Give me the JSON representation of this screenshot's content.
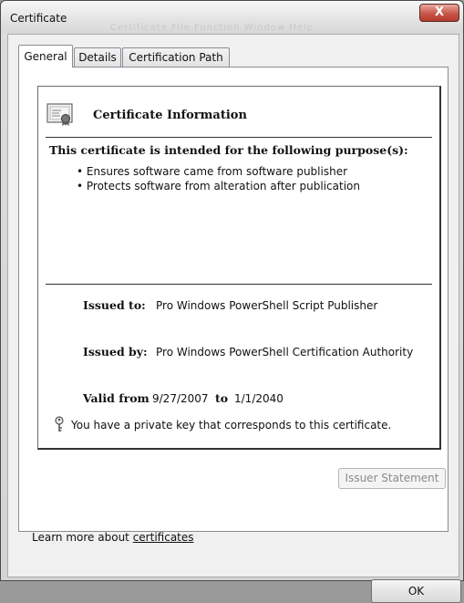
{
  "window": {
    "title": "Certificate",
    "background_title_ghost": "Certificate   File   Function   Window   Help",
    "close_label": "X"
  },
  "tabs": [
    {
      "label": "General",
      "active": true
    },
    {
      "label": "Details",
      "active": false
    },
    {
      "label": "Certification Path",
      "active": false
    }
  ],
  "general": {
    "info_title": "Certificate Information",
    "purpose_heading": "This certificate is intended for the following purpose(s):",
    "purposes": [
      "• Ensures software came from software publisher",
      "• Protects software from alteration after publication"
    ],
    "issued_to_label": "Issued to:",
    "issued_to_value": "Pro Windows PowerShell Script Publisher",
    "issued_by_label": "Issued by:",
    "issued_by_value": "Pro Windows PowerShell Certification Authority",
    "valid_from_label": "Valid from",
    "valid_from_value": "9/27/2007",
    "valid_to_label": "to",
    "valid_to_value": "1/1/2040",
    "private_key_text": "You have a private key that corresponds to this certificate."
  },
  "buttons": {
    "issuer_statement": "Issuer Statement",
    "ok": "OK"
  },
  "footer": {
    "learn_more_prefix": "Learn more about ",
    "learn_more_link": "certificates"
  },
  "icons": {
    "certificate": "certificate-icon",
    "key": "key-icon",
    "close": "close-icon"
  }
}
